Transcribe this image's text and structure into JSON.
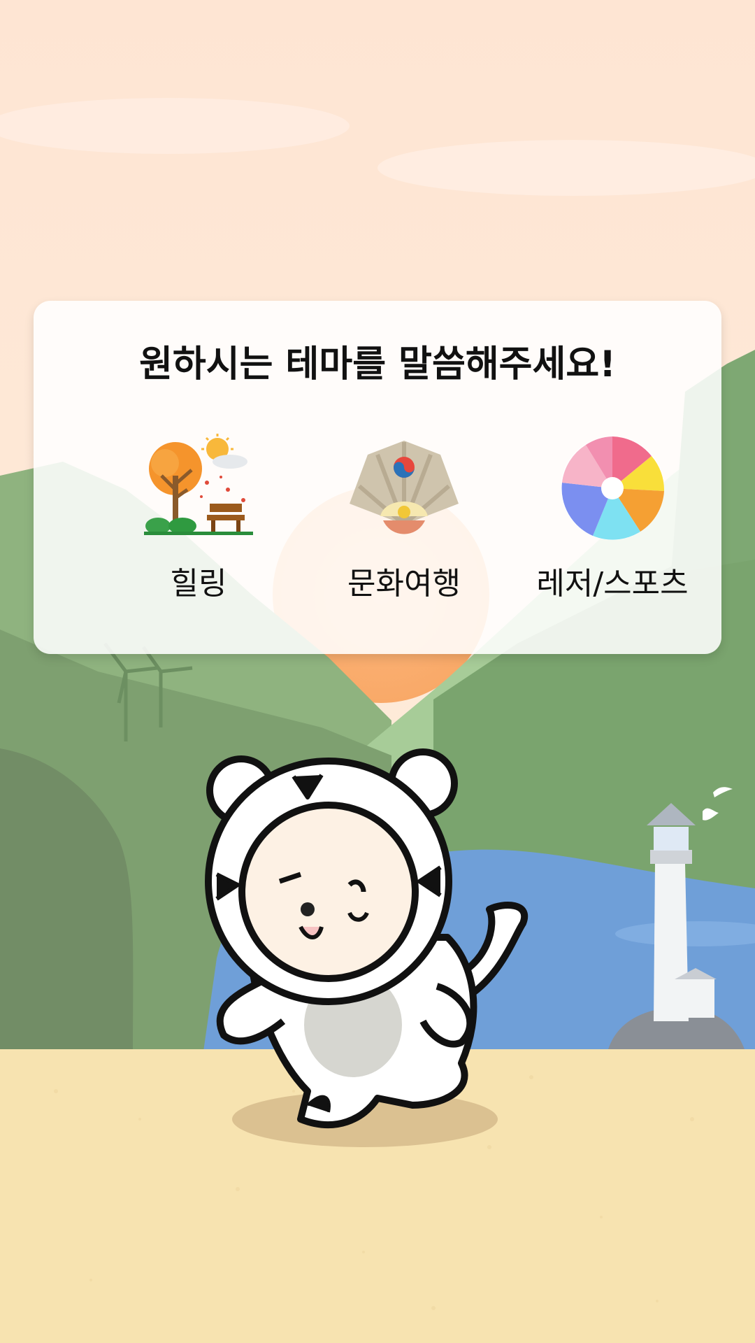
{
  "prompt": {
    "title": "원하시는 테마를 말씀해주세요!"
  },
  "themes": [
    {
      "label": "힐링",
      "icon": "autumn-park-icon"
    },
    {
      "label": "문화여행",
      "icon": "korean-fan-icon"
    },
    {
      "label": "레저/스포츠",
      "icon": "beach-ball-icon"
    }
  ],
  "colors": {
    "sky": "#fde7d6",
    "sand": "#f7e3b0",
    "water": "#6f9fd8",
    "hill": "#7aa46e",
    "sun": "#f9b06c"
  },
  "mascot": {
    "icon": "white-tiger-mascot-icon"
  },
  "decor": [
    "lighthouse-icon",
    "seagull-icon",
    "wind-turbine-icon",
    "sun-icon"
  ]
}
